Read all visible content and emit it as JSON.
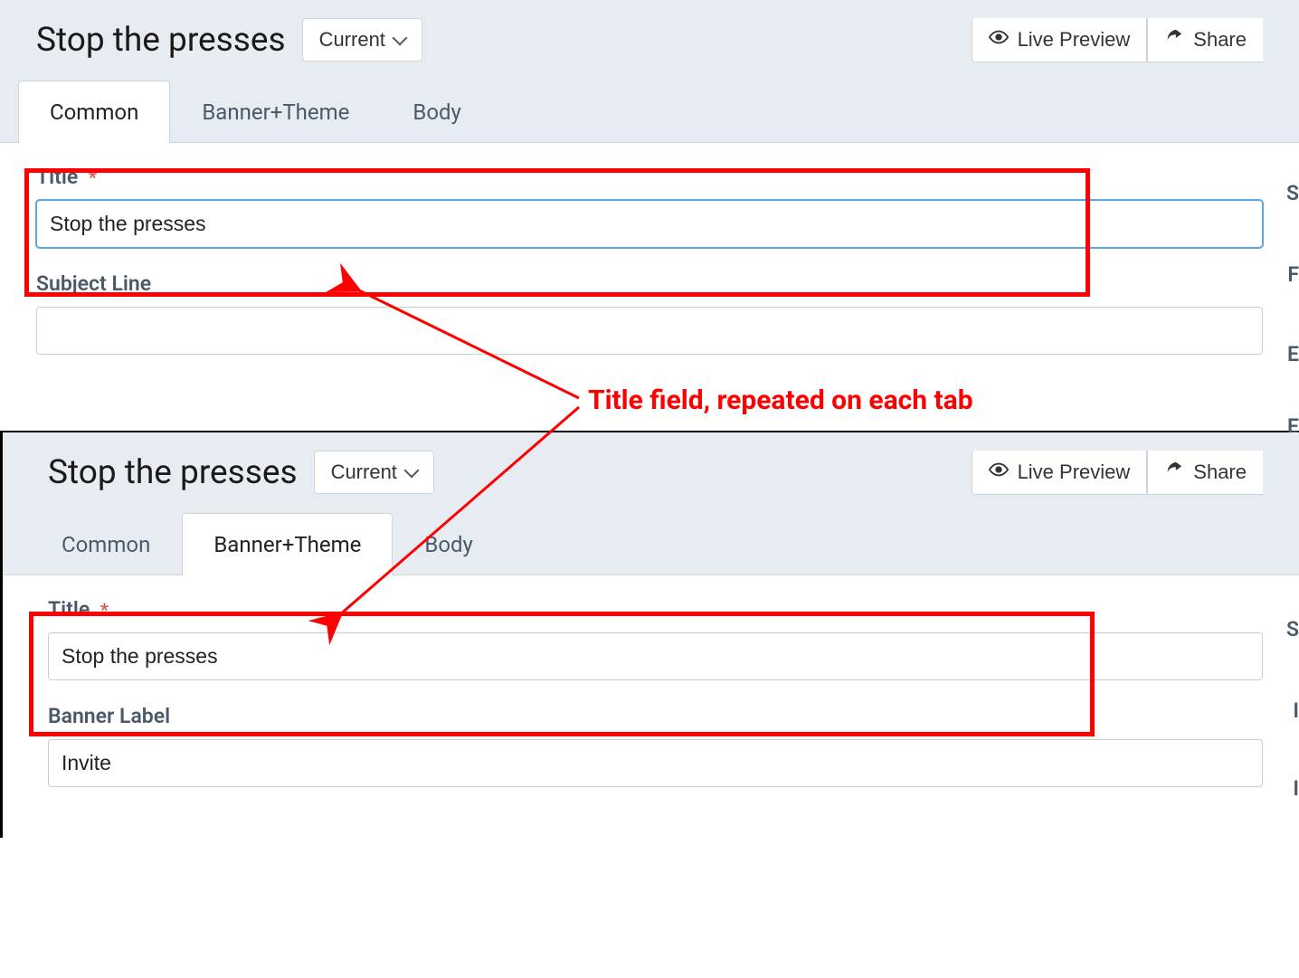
{
  "top": {
    "header": {
      "title": "Stop the presses",
      "dropdown_label": "Current",
      "live_preview": "Live Preview",
      "share": "Share"
    },
    "tabs": [
      "Common",
      "Banner+Theme",
      "Body"
    ],
    "active_tab": 0,
    "fields": {
      "title_label": "Title",
      "title_value": "Stop the presses",
      "subject_label": "Subject Line",
      "subject_value": ""
    }
  },
  "bottom": {
    "header": {
      "title": "Stop the presses",
      "dropdown_label": "Current",
      "live_preview": "Live Preview",
      "share": "Share"
    },
    "tabs": [
      "Common",
      "Banner+Theme",
      "Body"
    ],
    "active_tab": 1,
    "fields": {
      "title_label": "Title",
      "title_value": "Stop the presses",
      "banner_label_label": "Banner Label",
      "banner_label_value": "Invite"
    }
  },
  "annotation": "Title field, repeated on each tab",
  "required_mark": "*"
}
